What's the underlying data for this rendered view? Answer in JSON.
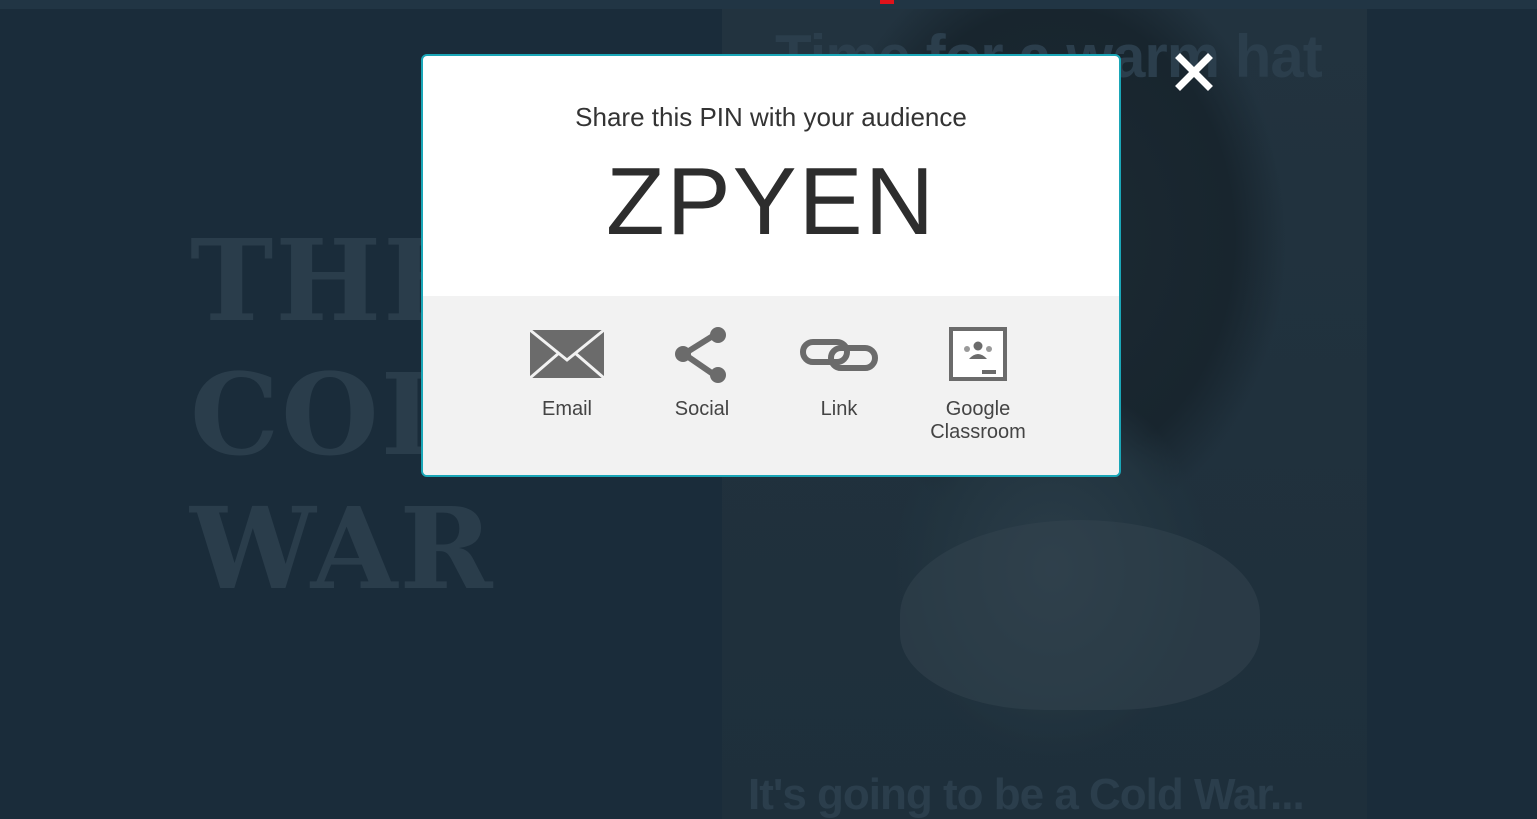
{
  "background_slide": {
    "left_title": "THE\nCOLD\nWAR",
    "caption_top": "Time for a warm hat",
    "caption_bottom": "It's going to be a Cold War..."
  },
  "modal": {
    "subtitle": "Share this PIN with your audience",
    "pin": "ZPYEN",
    "border_color": "#1aa6b7",
    "share_options": [
      {
        "label": "Email",
        "icon": "envelope-icon"
      },
      {
        "label": "Social",
        "icon": "share-icon"
      },
      {
        "label": "Link",
        "icon": "chain-link-icon"
      },
      {
        "label": "Google\nClassroom",
        "icon": "google-classroom-icon"
      }
    ]
  },
  "close_icon": "close-icon"
}
